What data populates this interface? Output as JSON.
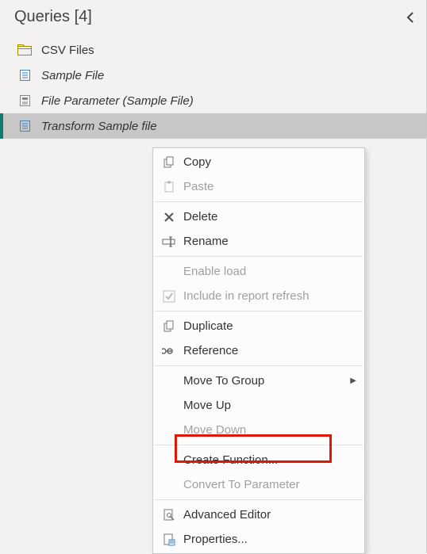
{
  "panel": {
    "title": "Queries [4]"
  },
  "queries": [
    {
      "label": "CSV Files",
      "icon": "folder-icon",
      "italic": false,
      "selected": false
    },
    {
      "label": "Sample File",
      "icon": "doc-icon",
      "italic": true,
      "selected": false
    },
    {
      "label": "File Parameter (Sample File)",
      "icon": "param-icon",
      "italic": true,
      "selected": false
    },
    {
      "label": "Transform Sample file",
      "icon": "doc-icon",
      "italic": true,
      "selected": true
    }
  ],
  "context_menu": [
    {
      "label": "Copy",
      "icon": "copy-icon",
      "disabled": false
    },
    {
      "label": "Paste",
      "icon": "paste-icon",
      "disabled": true
    },
    {
      "sep": true
    },
    {
      "label": "Delete",
      "icon": "delete-icon",
      "disabled": false
    },
    {
      "label": "Rename",
      "icon": "rename-icon",
      "disabled": false
    },
    {
      "sep": true
    },
    {
      "label": "Enable load",
      "icon": "blank-icon",
      "disabled": true
    },
    {
      "label": "Include in report refresh",
      "icon": "check-icon",
      "disabled": true
    },
    {
      "sep": true
    },
    {
      "label": "Duplicate",
      "icon": "copy-icon",
      "disabled": false
    },
    {
      "label": "Reference",
      "icon": "link-icon",
      "disabled": false
    },
    {
      "sep": true
    },
    {
      "label": "Move To Group",
      "icon": "blank-icon",
      "disabled": false,
      "submenu": true
    },
    {
      "label": "Move Up",
      "icon": "blank-icon",
      "disabled": false
    },
    {
      "label": "Move Down",
      "icon": "blank-icon",
      "disabled": true
    },
    {
      "sep": true
    },
    {
      "label": "Create Function...",
      "icon": "blank-icon",
      "disabled": false,
      "highlight": true
    },
    {
      "label": "Convert To Parameter",
      "icon": "blank-icon",
      "disabled": true
    },
    {
      "sep": true
    },
    {
      "label": "Advanced Editor",
      "icon": "adv-icon",
      "disabled": false
    },
    {
      "label": "Properties...",
      "icon": "props-icon",
      "disabled": false
    }
  ]
}
